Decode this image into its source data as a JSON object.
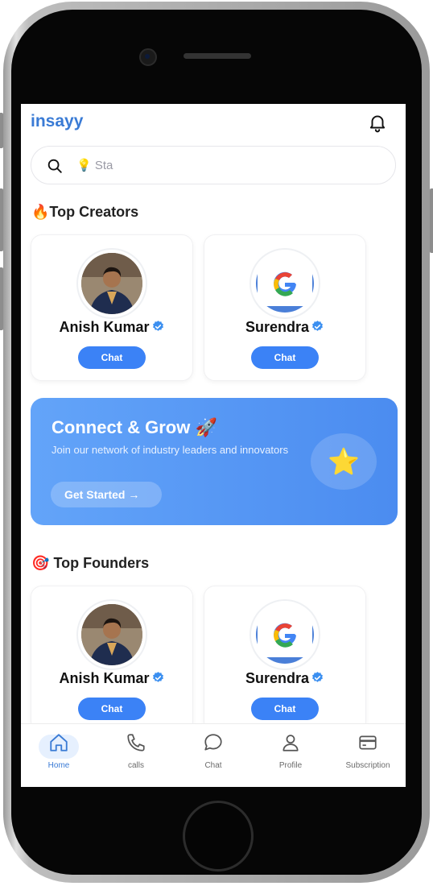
{
  "app": {
    "brand": "insayy"
  },
  "search": {
    "placeholder_emoji": "💡",
    "placeholder": "Sta"
  },
  "sections": {
    "top_creators": {
      "emoji": "🔥",
      "title": "Top Creators"
    },
    "top_founders": {
      "emoji": "🎯",
      "title": "Top Founders"
    }
  },
  "creators": [
    {
      "name": "Anish Kumar",
      "chat_label": "Chat"
    },
    {
      "name": "Surendra",
      "chat_label": "Chat"
    }
  ],
  "founders": [
    {
      "name": "Anish Kumar",
      "chat_label": "Chat"
    },
    {
      "name": "Surendra",
      "chat_label": "Chat"
    }
  ],
  "banner": {
    "title": "Connect & Grow",
    "title_emoji": "🚀",
    "subtitle": "Join our network of industry leaders and innovators",
    "button": "Get Started →",
    "star_emoji": "⭐"
  },
  "nav": [
    {
      "label": "Home",
      "icon": "home-icon"
    },
    {
      "label": "calls",
      "icon": "phone-icon"
    },
    {
      "label": "Chat",
      "icon": "chat-bubble-icon"
    },
    {
      "label": "Profile",
      "icon": "user-icon"
    },
    {
      "label": "Subscription",
      "icon": "card-icon"
    }
  ],
  "colors": {
    "brand": "#3a7bd5",
    "accent": "#3b82f6",
    "verified": "#3b8ff0"
  }
}
